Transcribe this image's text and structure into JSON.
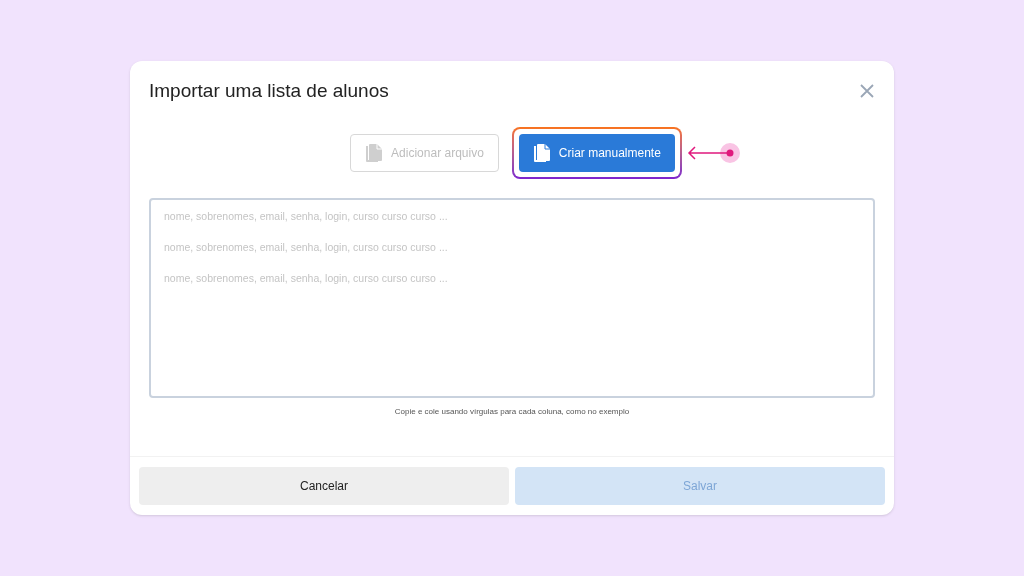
{
  "dialog": {
    "title": "Importar uma lista de alunos"
  },
  "modes": [
    {
      "label": "Adicionar arquivo",
      "selected": false,
      "highlighted": false
    },
    {
      "label": "Criar manualmente",
      "selected": true,
      "highlighted": true
    }
  ],
  "text_area": {
    "placeholder_lines": [
      "nome, sobrenomes, email, senha, login, curso curso curso ...",
      "nome, sobrenomes, email, senha, login, curso curso curso ...",
      "nome, sobrenomes, email, senha, login, curso curso curso ..."
    ]
  },
  "hint": "Copie e cole usando vírgulas para cada coluna, como no exemplo",
  "buttons": [
    {
      "label": "Cancelar",
      "disabled": false
    },
    {
      "label": "Salvar",
      "disabled": true
    }
  ]
}
